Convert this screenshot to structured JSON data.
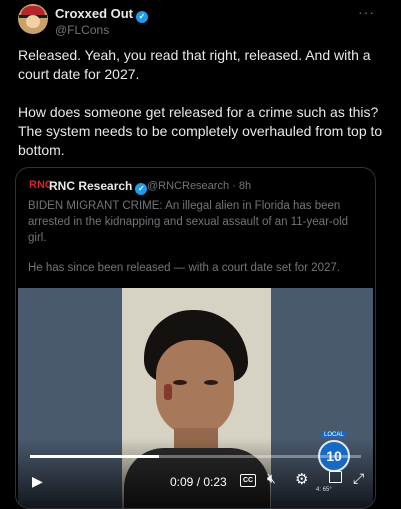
{
  "post": {
    "author_name": "Croxxed Out",
    "handle": "@FLCons",
    "more_glyph": "···",
    "paragraphs": [
      "Released. Yeah, you read that right, released. And with a court date for 2027.",
      "How does someone get released for a crime such as this? The system needs to be completely overhauled from top to bottom."
    ]
  },
  "quote": {
    "logo_text": "RNC",
    "author_name": "RNC Research",
    "handle_time": "@RNCResearch · 8h",
    "paragraphs": [
      "BIDEN MIGRANT CRIME: An illegal alien in Florida has been arrested in the kidnapping and sexual assault of an 11-year-old girl.",
      "He has since been released — with a court date set for 2027."
    ]
  },
  "video": {
    "time_display": "0:09 / 0:23",
    "progress_fraction": 0.39,
    "cc_label": "CC",
    "station_badge": "10",
    "station_label": "LOCAL",
    "temperature_overlay": "4:  65°"
  },
  "icons": {
    "verified": "verified-badge-icon",
    "play": "play-icon",
    "captions": "captions-icon",
    "mute": "mute-icon",
    "settings": "gear-icon",
    "pip": "picture-in-picture-icon",
    "fullscreen": "fullscreen-icon"
  },
  "colors": {
    "background": "#000000",
    "text_primary": "#e7e9ea",
    "text_secondary": "#71767b",
    "verified_blue": "#1d9bf0",
    "rnc_red": "#d5212f",
    "border": "#2f3336"
  }
}
